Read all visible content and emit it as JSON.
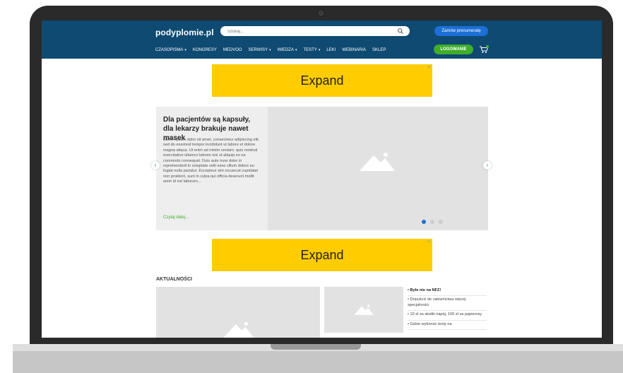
{
  "header": {
    "logo": "podyplomie.pl",
    "search_placeholder": "Szukaj...",
    "subscribe_label": "Zamów prenumeratę",
    "login_label": "LOGOWANIE"
  },
  "nav": {
    "items": [
      {
        "label": "CZASOPISMA",
        "caret": "▾"
      },
      {
        "label": "KONGRESY",
        "caret": ""
      },
      {
        "label": "MEDVOO",
        "caret": ""
      },
      {
        "label": "SERWISY",
        "caret": "▾"
      },
      {
        "label": "WIEDZA",
        "caret": "▾"
      },
      {
        "label": "TESTY",
        "caret": "▾"
      },
      {
        "label": "LEKI",
        "caret": ""
      },
      {
        "label": "WEBINARIA",
        "caret": ""
      },
      {
        "label": "SKLEP",
        "caret": ""
      }
    ]
  },
  "ads": {
    "top": {
      "label": "Expand",
      "close": "✕"
    },
    "bottom": {
      "label": "Expand",
      "close": "✕"
    }
  },
  "slider": {
    "title": "Dla pacjentów są kapsuły, dla lekarzy brakuje nawet masek",
    "body": "Lorem ipsum dolor sit amet, consectetur adipiscing elit, sed do eiusmod tempor incididunt ut labore et dolore magna aliqua. Ut enim ad minim veniam, quis nostrud exercitation ullamco laboris nisi ut aliquip ex ea commodo consequat. Duis aute irure dolor in reprehenderit in voluptate velit esse cillum dolore eu fugiat nulla pariatur. Excepteur sint occaecat cupidatat non proident, sunt in culpa qui officia deserunt mollit anim id est laborum...",
    "read_more": "Czytaj dalej...",
    "prev_icon": "‹",
    "next_icon": "›",
    "active_dot": 0
  },
  "news": {
    "heading": "AKTUALNOŚCI",
    "items": [
      "Byłe nie na NFZ!",
      "Dopuścić do ratownictwa więcej specjalności",
      "10 zł za słodki napój, 100 zł za papierosy",
      "Gdzie wykonać testy na"
    ]
  },
  "colors": {
    "header_bg": "#0e4a72",
    "accent_blue": "#1c6fd6",
    "accent_green": "#3fae2a",
    "ad_yellow": "#ffcc00"
  }
}
